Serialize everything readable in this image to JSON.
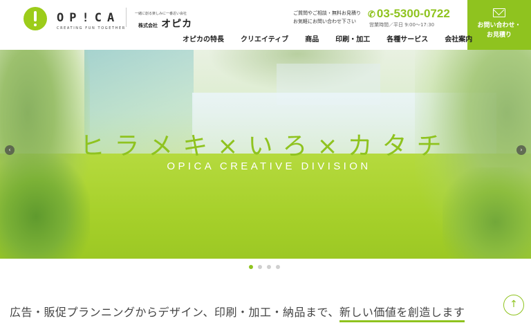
{
  "logo": {
    "wordmark": "OP!CA",
    "tagline": "CREATING FUN TOGETHER"
  },
  "company": {
    "tagline": "一緒に創る楽しみに一番近い会社",
    "prefix": "株式会社",
    "name": "オピカ"
  },
  "contact": {
    "note_line1": "ご質問やご相談・無料お見積り",
    "note_line2": "お気軽にお問い合わせ下さい",
    "phone": "03-5300-0722",
    "hours": "営業時間／平日 9:00〜17:30",
    "cta_line1": "お問い合わせ・",
    "cta_line2": "お見積り"
  },
  "nav": {
    "items": [
      "オピカの特長",
      "クリエイティブ",
      "商品",
      "印刷・加工",
      "各種サービス",
      "会社案内"
    ]
  },
  "hero": {
    "title": "ヒラメキ×いろ×カタチ",
    "subtitle": "OPICA CREATIVE DIVISION",
    "prev_arrow": "‹",
    "next_arrow": "›"
  },
  "slider": {
    "slide_count": 4,
    "active_index": 0
  },
  "intro": {
    "text": "広告・販促プランニングからデザイン、印刷・加工・納品まで、",
    "highlight": "新しい価値を創造します"
  },
  "scroll_top": "↑",
  "colors": {
    "accent": "#8fc31f",
    "text": "#333333"
  },
  "icons": {
    "phone": "phone-icon",
    "mail": "mail-icon",
    "scroll": "arrow-up-icon"
  }
}
